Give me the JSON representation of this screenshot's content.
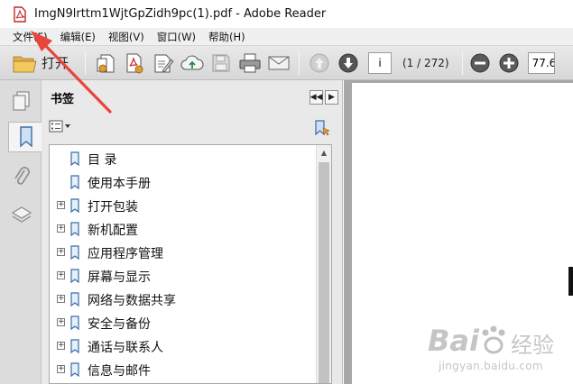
{
  "window": {
    "title": "ImgN9lrttm1WjtGpZidh9pc(1).pdf - Adobe Reader"
  },
  "menu": {
    "items": [
      "文件(F)",
      "编辑(E)",
      "视图(V)",
      "窗口(W)",
      "帮助(H)"
    ]
  },
  "toolbar": {
    "open_label": "打开",
    "current_page": "i",
    "page_count": "(1 / 272)",
    "zoom": "77.6"
  },
  "bookmarks": {
    "title": "书签",
    "items": [
      {
        "label": "目  录",
        "expandable": false
      },
      {
        "label": "使用本手册",
        "expandable": false
      },
      {
        "label": "打开包装",
        "expandable": true
      },
      {
        "label": "新机配置",
        "expandable": true
      },
      {
        "label": "应用程序管理",
        "expandable": true
      },
      {
        "label": "屏幕与显示",
        "expandable": true
      },
      {
        "label": "网络与数据共享",
        "expandable": true
      },
      {
        "label": "安全与备份",
        "expandable": true
      },
      {
        "label": "通话与联系人",
        "expandable": true
      },
      {
        "label": "信息与邮件",
        "expandable": true
      }
    ]
  },
  "watermark": {
    "brand": "Bai",
    "brand_suffix": "经验",
    "url": "jingyan.baidu.com"
  },
  "colors": {
    "annotation_arrow": "#e8453c",
    "pdf_icon": "#c0282a",
    "bookmark_icon": "#3a6da8"
  }
}
